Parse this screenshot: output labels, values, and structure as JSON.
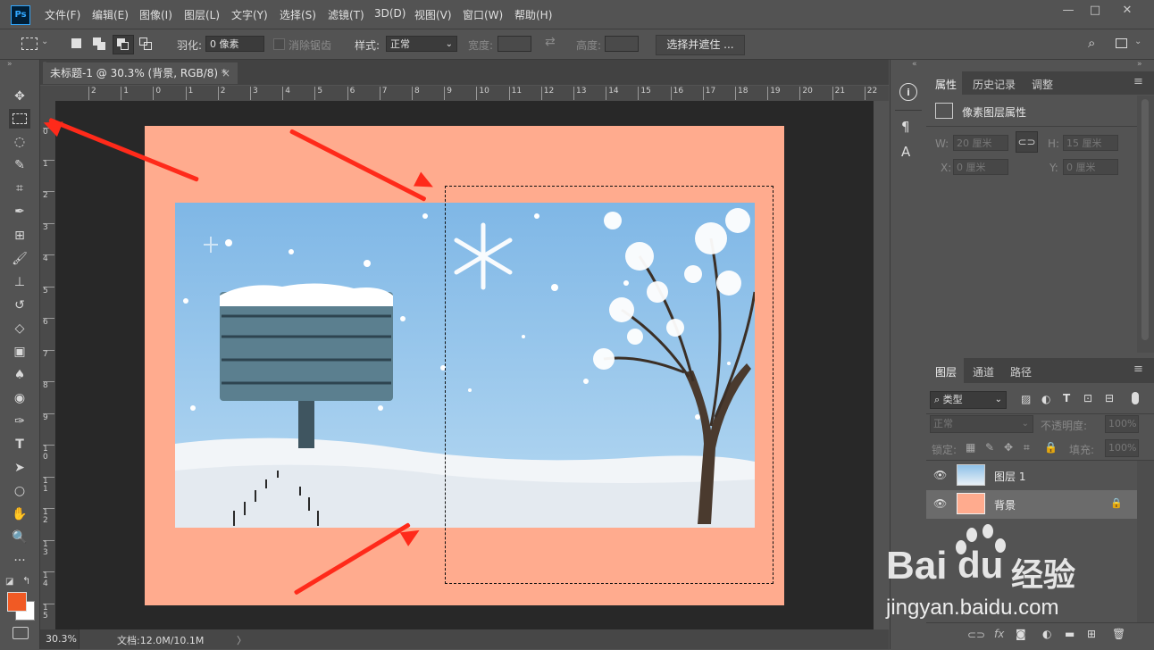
{
  "app": {
    "logo": "Ps"
  },
  "menu": [
    "文件(F)",
    "编辑(E)",
    "图像(I)",
    "图层(L)",
    "文字(Y)",
    "选择(S)",
    "滤镜(T)",
    "3D(D)",
    "视图(V)",
    "窗口(W)",
    "帮助(H)"
  ],
  "window_controls": {
    "minimize": "—",
    "maximize": "□",
    "close": "✕"
  },
  "options": {
    "feather_label": "羽化:",
    "feather_value": "0 像素",
    "antialias_label": "消除锯齿",
    "style_label": "样式:",
    "style_value": "正常",
    "width_label": "宽度:",
    "height_label": "高度:",
    "select_mask_button": "选择并遮住 ..."
  },
  "document": {
    "tab_title": "未标题-1 @ 30.3% (背景, RGB/8) *",
    "close": "×",
    "zoom": "30.3%",
    "doc_size": "文档:12.0M/10.1M",
    "status_arrow": "〉"
  },
  "ruler": {
    "h_ticks": [
      "2",
      "1",
      "0",
      "1",
      "2",
      "3",
      "4",
      "5",
      "6",
      "7",
      "8",
      "9",
      "10",
      "11",
      "12",
      "13",
      "14",
      "15",
      "16",
      "17",
      "18",
      "19",
      "20",
      "21",
      "22"
    ],
    "v_ticks": [
      "0",
      "1",
      "2",
      "3",
      "4",
      "5",
      "6",
      "7",
      "8",
      "9",
      "1\n0",
      "1\n1",
      "1\n2",
      "1\n3",
      "1\n4",
      "1\n5"
    ]
  },
  "properties_panel": {
    "tabs": [
      "属性",
      "历史记录",
      "调整"
    ],
    "header": "像素图层属性",
    "w_label": "W:",
    "w_value": "20 厘米",
    "h_label": "H:",
    "h_value": "15 厘米",
    "x_label": "X:",
    "x_value": "0 厘米",
    "y_label": "Y:",
    "y_value": "0 厘米"
  },
  "layers_panel": {
    "tabs": [
      "图层",
      "通道",
      "路径"
    ],
    "filter_label": "类型",
    "blend_mode": "正常",
    "opacity_label": "不透明度:",
    "opacity_value": "100%",
    "lock_label": "锁定:",
    "fill_label": "填充:",
    "fill_value": "100%",
    "layers": [
      {
        "name": "图层 1",
        "type": "image"
      },
      {
        "name": "背景",
        "type": "background",
        "locked": true
      }
    ]
  },
  "colors": {
    "foreground": "#f15a24",
    "background": "#ffffff",
    "artboard": "#ffab8e",
    "sky": "#8ec1e8"
  },
  "watermark": {
    "brand": "Bai",
    "brand2": "du",
    "brand_cn": "经验",
    "url": "jingyan.baidu.com"
  }
}
